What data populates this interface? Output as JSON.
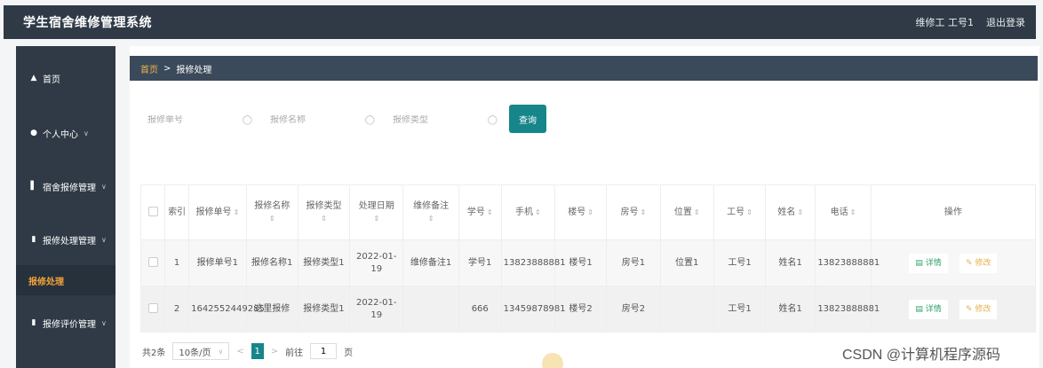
{
  "app_title": "学生宿舍维修管理系统",
  "header": {
    "user": "维修工 工号1",
    "logout": "退出登录"
  },
  "sidebar": {
    "items": [
      {
        "label": "首页",
        "icon": "home-icon"
      },
      {
        "label": "个人中心",
        "icon": "user-icon"
      },
      {
        "label": "宿舍报修管理",
        "icon": "chart-icon"
      },
      {
        "label": "报修处理管理",
        "icon": "clipboard-icon"
      },
      {
        "label": "报修评价管理",
        "icon": "clipboard-icon"
      }
    ],
    "active_sub": "报修处理"
  },
  "breadcrumb": {
    "home": "首页",
    "sep": ">",
    "current": "报修处理"
  },
  "search": {
    "field1_placeholder": "报修单号",
    "field2_placeholder": "报修名称",
    "field3_placeholder": "报修类型",
    "query_label": "查询"
  },
  "table": {
    "headers": {
      "index": "索引",
      "order_no": "报修单号",
      "name": "报修名称",
      "type": "报修类型",
      "date": "处理日期",
      "note": "维修备注",
      "student_no": "学号",
      "phone": "手机",
      "building": "楼号",
      "room": "房号",
      "position": "位置",
      "worker_no": "工号",
      "worker_name": "姓名",
      "tel": "电话",
      "ops": "操作"
    },
    "rows": [
      {
        "index": "1",
        "order_no": "报修单号1",
        "name": "报修名称1",
        "type": "报修类型1",
        "date": "2022-01-19",
        "note": "维修备注1",
        "student_no": "学号1",
        "phone": "13823888881",
        "building": "楼号1",
        "room": "房号1",
        "position": "位置1",
        "worker_no": "工号1",
        "worker_name": "姓名1",
        "tel": "13823888881"
      },
      {
        "index": "2",
        "order_no": "1642552449285",
        "name": "这里报修",
        "type": "报修类型1",
        "date": "2022-01-19",
        "note": "",
        "student_no": "666",
        "phone": "13459878981",
        "building": "楼号2",
        "room": "房号2",
        "position": "",
        "worker_no": "工号1",
        "worker_name": "姓名1",
        "tel": "13823888881"
      }
    ],
    "actions": {
      "detail": "详情",
      "edit": "修改"
    }
  },
  "pagination": {
    "total": "共2条",
    "page_size": "10条/页",
    "current_page": "1",
    "goto_prefix": "前往",
    "goto_value": "1",
    "goto_suffix": "页"
  },
  "watermark": "CSDN @计算机程序源码"
}
